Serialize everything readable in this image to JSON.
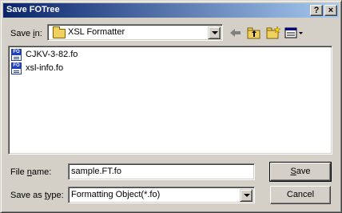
{
  "window": {
    "title": "Save FOTree",
    "help_label": "?",
    "close_label": "×"
  },
  "save_in": {
    "label_prefix": "Save ",
    "label_hotkey": "i",
    "label_suffix": "n:",
    "value": "XSL Formatter"
  },
  "toolbar": {
    "icons": [
      "back-arrow-icon",
      "up-folder-icon",
      "new-folder-icon",
      "view-menu-icon"
    ]
  },
  "files": [
    {
      "name": "CJKV-3-82.fo",
      "icon": "fo-file-icon",
      "badge": "FO"
    },
    {
      "name": "xsl-info.fo",
      "icon": "fo-file-icon",
      "badge": "FO"
    }
  ],
  "file_name": {
    "label_prefix": "File ",
    "label_hotkey": "n",
    "label_suffix": "ame:",
    "value": "sample.FT.fo"
  },
  "save_as_type": {
    "label_prefix": "Save as ",
    "label_hotkey": "t",
    "label_suffix": "ype:",
    "value": "Formatting Object(*.fo)"
  },
  "buttons": {
    "save_hotkey": "S",
    "save_rest": "ave",
    "cancel_label": "Cancel"
  },
  "colors": {
    "title_start": "#0a246a",
    "title_end": "#a6caf0",
    "face": "#d4d0c8"
  }
}
